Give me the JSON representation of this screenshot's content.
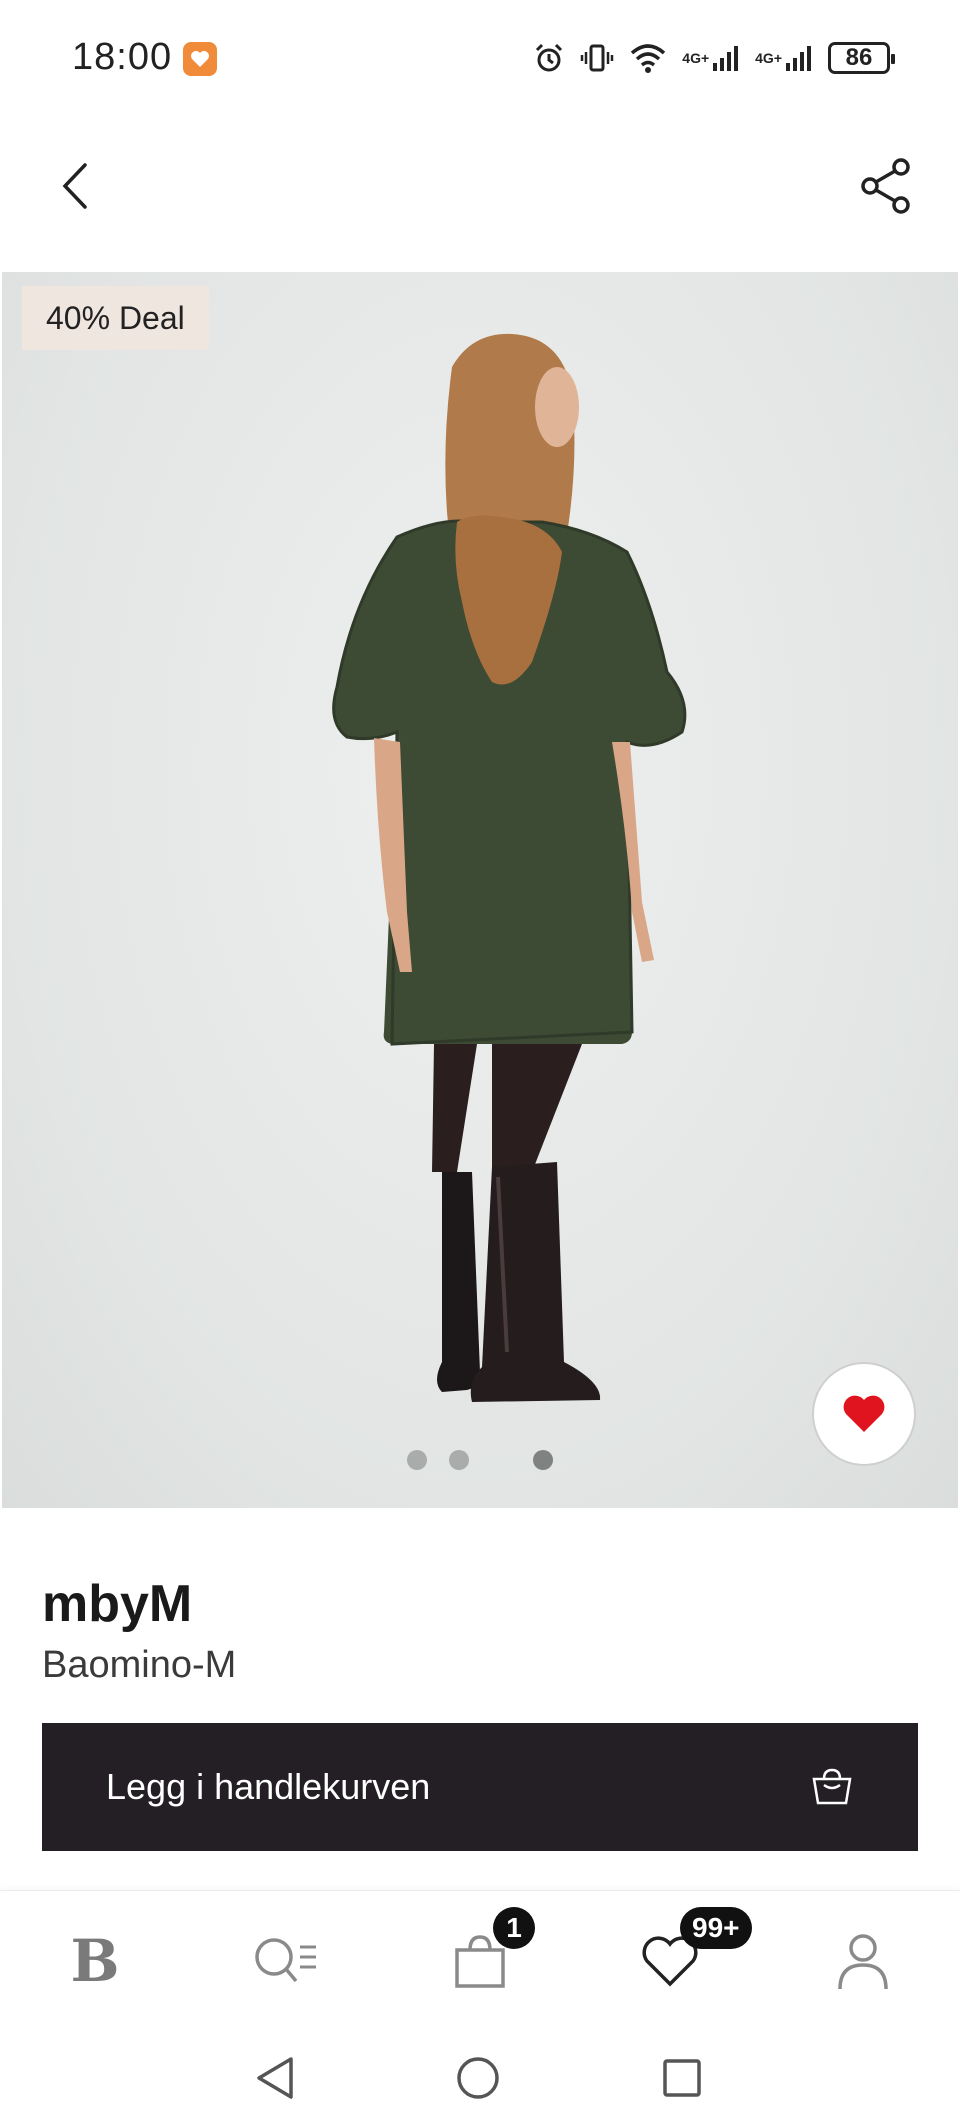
{
  "status_bar": {
    "time": "18:00",
    "battery": "86",
    "network_1": "4G+",
    "network_2": "4G+"
  },
  "nav": {
    "back_icon": "chevron-left-icon",
    "share_icon": "share-icon"
  },
  "product": {
    "deal_badge": "40% Deal",
    "brand": "mbyM",
    "name": "Baomino-M",
    "image_count": 4,
    "active_image_index": 3,
    "favorite": true,
    "favorite_color": "#e0141e"
  },
  "cart_button": {
    "label": "Legg i handlekurven",
    "icon": "shopping-bag-icon",
    "background": "#231f24"
  },
  "tabbar": {
    "home_logo": "B",
    "cart_badge": "1",
    "favorites_badge": "99+"
  }
}
